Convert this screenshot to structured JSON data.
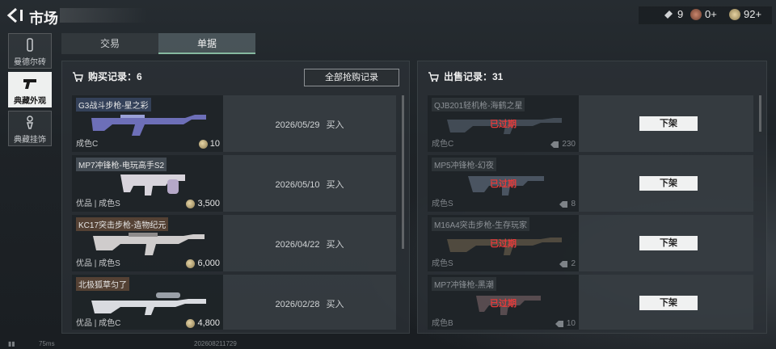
{
  "header": {
    "title": "市场"
  },
  "currencies": [
    {
      "icon": "ticket-icon",
      "value": "9"
    },
    {
      "icon": "gem-coin-icon",
      "value": "0+"
    },
    {
      "icon": "gold-coin-icon",
      "value": "92+"
    }
  ],
  "sidebar": {
    "items": [
      {
        "label": "曼德尔砖",
        "icon": "mandel-brick-icon"
      },
      {
        "label": "典藏外观",
        "icon": "pistol-icon"
      },
      {
        "label": "典藏挂饰",
        "icon": "charm-icon"
      }
    ]
  },
  "tabs": [
    {
      "label": "交易"
    },
    {
      "label": "单据"
    }
  ],
  "purchase": {
    "title": "购买记录：6",
    "all_button": "全部抢购记录",
    "rows": [
      {
        "name": "G3战斗步枪-星之彩",
        "quality": "成色C",
        "price": "10",
        "date": "2026/05/29",
        "action": "买入"
      },
      {
        "name": "MP7冲锋枪-电玩高手S2",
        "quality": "优品 | 成色S",
        "price": "3,500",
        "date": "2026/05/10",
        "action": "买入"
      },
      {
        "name": "KC17突击步枪-造物纪元",
        "quality": "优品 | 成色S",
        "price": "6,000",
        "date": "2026/04/22",
        "action": "买入"
      },
      {
        "name": "北极狐草匀了",
        "quality": "优品 | 成色C",
        "price": "4,800",
        "date": "2026/02/28",
        "action": "买入"
      }
    ]
  },
  "sales": {
    "title": "出售记录：31",
    "rows": [
      {
        "name": "QJB201轻机枪-海鹤之星",
        "quality": "成色C",
        "price": "230",
        "status": "已过期",
        "button": "下架"
      },
      {
        "name": "MP5冲锋枪-幻夜",
        "quality": "成色S",
        "price": "8",
        "status": "已过期",
        "button": "下架"
      },
      {
        "name": "M16A4突击步枪-生存玩家",
        "quality": "成色S",
        "price": "2",
        "status": "已过期",
        "button": "下架"
      },
      {
        "name": "MP7冲锋枪-黑潮",
        "quality": "成色B",
        "price": "10",
        "status": "已过期",
        "button": "下架"
      }
    ]
  },
  "statusbar": {
    "ping": "75ms",
    "id": "202608211729"
  },
  "colors": {
    "accent": "#86b9a0",
    "expired": "#e23b3b",
    "background": "#1b2024"
  }
}
